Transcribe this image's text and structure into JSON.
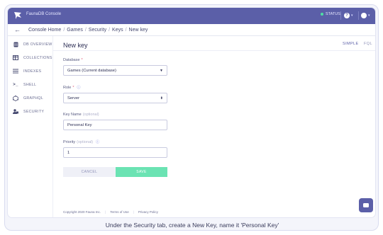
{
  "app": {
    "title": "FaunaDB Console",
    "status": "STATUS"
  },
  "breadcrumb": [
    "Console Home",
    "Games",
    "Security",
    "Keys",
    "New key"
  ],
  "sidebar": {
    "items": [
      {
        "label": "DB OVERVIEW",
        "icon": "database-icon"
      },
      {
        "label": "COLLECTIONS",
        "icon": "table-icon"
      },
      {
        "label": "INDEXES",
        "icon": "list-icon"
      },
      {
        "label": "SHELL",
        "icon": "terminal-icon"
      },
      {
        "label": "GRAPHQL",
        "icon": "graphql-icon"
      },
      {
        "label": "SECURITY",
        "icon": "security-icon"
      }
    ]
  },
  "main": {
    "title": "New key",
    "tabs": [
      "SIMPLE",
      "FQL"
    ]
  },
  "form": {
    "database_label": "Database",
    "database_value": "Games (Current database)",
    "role_label": "Role",
    "role_value": "Server",
    "keyname_label": "Key Name",
    "keyname_optional": "(optional)",
    "keyname_value": "Personal Key",
    "priority_label": "Priority",
    "priority_optional": "(optional)",
    "priority_value": "1",
    "cancel_label": "CANCEL",
    "save_label": "SAVE"
  },
  "footer": {
    "copyright": "Copyright 2020 Fauna Inc.",
    "terms": "Terms of Use",
    "privacy": "Privacy Policy"
  },
  "caption": "Under the Security tab, create a New Key, name it 'Personal Key'",
  "colors": {
    "accent": "#5b5fa8",
    "save": "#6be3b3",
    "status_dot": "#4ee0a3"
  }
}
